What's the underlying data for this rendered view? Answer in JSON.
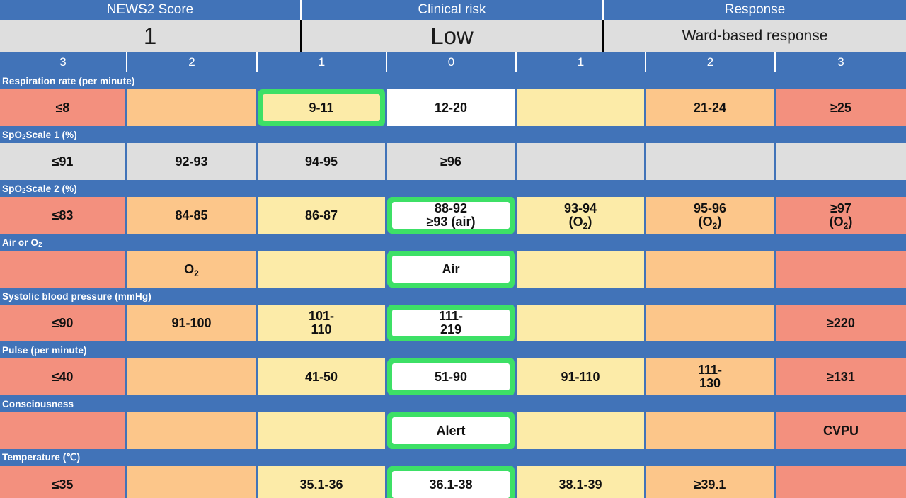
{
  "header": {
    "titles": [
      {
        "label": "NEWS2 Score"
      },
      {
        "label": "Clinical risk"
      },
      {
        "label": "Response"
      }
    ],
    "values": {
      "news2_score": "1",
      "clinical_risk": "Low",
      "response": "Ward-based response"
    }
  },
  "score_scale": [
    "3",
    "2",
    "1",
    "0",
    "1",
    "2",
    "3"
  ],
  "parameters": [
    {
      "label": "Respiration rate (per minute)",
      "label_html": "Respiration rate (per minute)",
      "cells": [
        {
          "text": "≤8",
          "color": "red",
          "highlight": false
        },
        {
          "text": "",
          "color": "orange",
          "highlight": false
        },
        {
          "text": "9-11",
          "color": "yellow",
          "highlight": true,
          "inner": "yellow"
        },
        {
          "text": "12-20",
          "color": "white",
          "highlight": false
        },
        {
          "text": "",
          "color": "yellow",
          "highlight": false
        },
        {
          "text": "21-24",
          "color": "orange",
          "highlight": false
        },
        {
          "text": "≥25",
          "color": "red",
          "highlight": false
        }
      ]
    },
    {
      "label": "SpO2 Scale 1 (%)",
      "label_html": "SpO<sub>2</sub> Scale 1 (%)",
      "cells": [
        {
          "text": "≤91",
          "color": "grey",
          "highlight": false
        },
        {
          "text": "92-93",
          "color": "grey",
          "highlight": false
        },
        {
          "text": "94-95",
          "color": "grey",
          "highlight": false
        },
        {
          "text": "≥96",
          "color": "grey",
          "highlight": false
        },
        {
          "text": "",
          "color": "grey",
          "highlight": false
        },
        {
          "text": "",
          "color": "grey",
          "highlight": false
        },
        {
          "text": "",
          "color": "grey",
          "highlight": false
        }
      ]
    },
    {
      "label": "SpO2 Scale 2 (%)",
      "label_html": "SpO<sub>2</sub> Scale 2 (%)",
      "cells": [
        {
          "text": "≤83",
          "color": "red",
          "highlight": false
        },
        {
          "text": "84-85",
          "color": "orange",
          "highlight": false
        },
        {
          "text": "86-87",
          "color": "yellow",
          "highlight": false
        },
        {
          "text": "88-92 ≥93 (air)",
          "text_html": "88-92<br>≥93 (air)",
          "color": "white",
          "highlight": true,
          "inner": "white"
        },
        {
          "text": "93-94 (O2)",
          "text_html": "93-94<br>(O<sub>2</sub>)",
          "color": "yellow",
          "highlight": false
        },
        {
          "text": "95-96 (O2)",
          "text_html": "95-96<br>(O<sub>2</sub>)",
          "color": "orange",
          "highlight": false
        },
        {
          "text": "≥97 (O2)",
          "text_html": "≥97<br>(O<sub>2</sub>)",
          "color": "red",
          "highlight": false
        }
      ]
    },
    {
      "label": "Air or O2",
      "label_html": "Air or O<sub>2</sub>",
      "cells": [
        {
          "text": "",
          "color": "red",
          "highlight": false
        },
        {
          "text": "O2",
          "text_html": "O<sub>2</sub>",
          "color": "orange",
          "highlight": false
        },
        {
          "text": "",
          "color": "yellow",
          "highlight": false
        },
        {
          "text": "Air",
          "color": "white",
          "highlight": true,
          "inner": "white"
        },
        {
          "text": "",
          "color": "yellow",
          "highlight": false
        },
        {
          "text": "",
          "color": "orange",
          "highlight": false
        },
        {
          "text": "",
          "color": "red",
          "highlight": false
        }
      ]
    },
    {
      "label": "Systolic blood pressure (mmHg)",
      "label_html": "Systolic blood pressure (mmHg)",
      "cells": [
        {
          "text": "≤90",
          "color": "red",
          "highlight": false
        },
        {
          "text": "91-100",
          "color": "orange",
          "highlight": false
        },
        {
          "text": "101-110",
          "text_html": "101-<br>110",
          "color": "yellow",
          "highlight": false
        },
        {
          "text": "111-219",
          "text_html": "111-<br>219",
          "color": "white",
          "highlight": true,
          "inner": "white"
        },
        {
          "text": "",
          "color": "yellow",
          "highlight": false
        },
        {
          "text": "",
          "color": "orange",
          "highlight": false
        },
        {
          "text": "≥220",
          "color": "red",
          "highlight": false
        }
      ]
    },
    {
      "label": "Pulse (per minute)",
      "label_html": "Pulse (per minute)",
      "cells": [
        {
          "text": "≤40",
          "color": "red",
          "highlight": false
        },
        {
          "text": "",
          "color": "orange",
          "highlight": false
        },
        {
          "text": "41-50",
          "color": "yellow",
          "highlight": false
        },
        {
          "text": "51-90",
          "color": "white",
          "highlight": true,
          "inner": "white"
        },
        {
          "text": "91-110",
          "color": "yellow",
          "highlight": false
        },
        {
          "text": "111-130",
          "text_html": "111-<br>130",
          "color": "orange",
          "highlight": false
        },
        {
          "text": "≥131",
          "color": "red",
          "highlight": false
        }
      ]
    },
    {
      "label": "Consciousness",
      "label_html": "Consciousness",
      "cells": [
        {
          "text": "",
          "color": "red",
          "highlight": false
        },
        {
          "text": "",
          "color": "orange",
          "highlight": false
        },
        {
          "text": "",
          "color": "yellow",
          "highlight": false
        },
        {
          "text": "Alert",
          "color": "white",
          "highlight": true,
          "inner": "white"
        },
        {
          "text": "",
          "color": "yellow",
          "highlight": false
        },
        {
          "text": "",
          "color": "orange",
          "highlight": false
        },
        {
          "text": "CVPU",
          "color": "red",
          "highlight": false
        }
      ]
    },
    {
      "label": "Temperature (℃)",
      "label_html": "Temperature (℃)",
      "cells": [
        {
          "text": "≤35",
          "color": "red",
          "highlight": false
        },
        {
          "text": "",
          "color": "orange",
          "highlight": false
        },
        {
          "text": "35.1-36",
          "color": "yellow",
          "highlight": false
        },
        {
          "text": "36.1-38",
          "color": "white",
          "highlight": true,
          "inner": "white"
        },
        {
          "text": "38.1-39",
          "color": "yellow",
          "highlight": false
        },
        {
          "text": "≥39.1",
          "color": "orange",
          "highlight": false
        },
        {
          "text": "",
          "color": "red",
          "highlight": false
        }
      ]
    }
  ],
  "colors": {
    "blue": "#4173B8",
    "red": "#F3907E",
    "orange": "#FCC68A",
    "yellow": "#FCEBA8",
    "white": "#FFFFFF",
    "grey": "#DEDEDE",
    "green_highlight": "#3DE066"
  }
}
